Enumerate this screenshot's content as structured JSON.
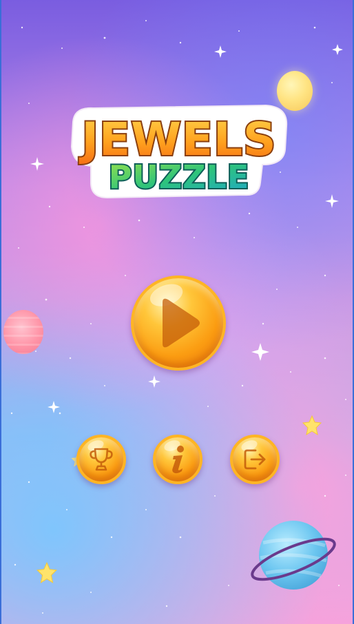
{
  "game": {
    "title_line1": "JEWELS",
    "title_line2": "PUZZLE"
  },
  "menu": {
    "play_icon": "play-icon",
    "leaderboard_icon": "trophy-icon",
    "info_icon": "info-icon",
    "exit_icon": "exit-icon"
  },
  "colors": {
    "button_orange": "#fb9d12",
    "title_orange": "#ff9a1a",
    "title_green": "#2bc46a"
  }
}
